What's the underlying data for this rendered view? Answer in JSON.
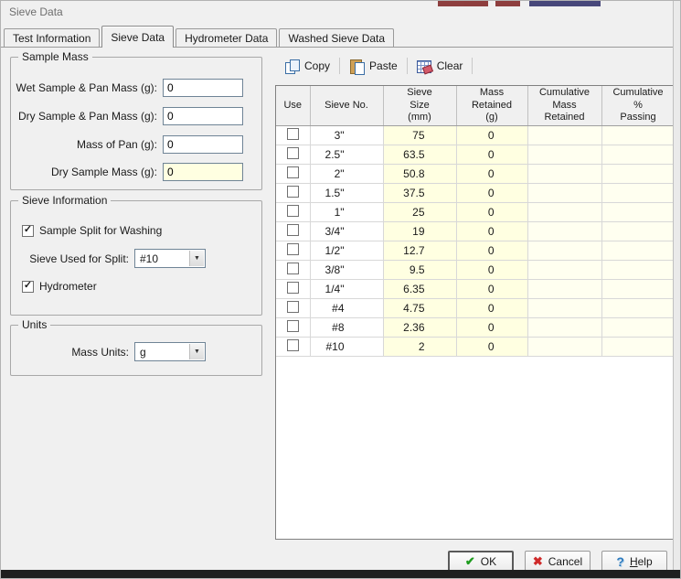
{
  "window": {
    "title": "Sieve Data"
  },
  "tabs": [
    {
      "label": "Test Information"
    },
    {
      "label": "Sieve Data"
    },
    {
      "label": "Hydrometer Data"
    },
    {
      "label": "Washed Sieve Data"
    }
  ],
  "sample_mass": {
    "title": "Sample Mass",
    "fields": [
      {
        "label": "Wet Sample & Pan Mass (g):",
        "value": "0"
      },
      {
        "label": "Dry Sample & Pan Mass (g):",
        "value": "0"
      },
      {
        "label": "Mass of Pan (g):",
        "value": "0"
      },
      {
        "label": "Dry Sample Mass (g):",
        "value": "0"
      }
    ]
  },
  "sieve_information": {
    "title": "Sieve Information",
    "sample_split_label": "Sample Split for Washing",
    "sample_split_checked": true,
    "sieve_used_label": "Sieve Used for Split:",
    "sieve_used_value": "#10",
    "hydrometer_label": "Hydrometer",
    "hydrometer_checked": true
  },
  "units": {
    "title": "Units",
    "mass_units_label": "Mass Units:",
    "mass_units_value": "g"
  },
  "toolbar": {
    "copy": "Copy",
    "paste": "Paste",
    "clear": "Clear"
  },
  "table": {
    "headers": [
      "Use",
      "Sieve No.",
      "Sieve\nSize\n(mm)",
      "Mass\nRetained\n(g)",
      "Cumulative\nMass\nRetained",
      "Cumulative\n%\nPassing"
    ],
    "rows": [
      {
        "no": "3\"",
        "size": "75",
        "mass": "0",
        "cum_mass": "",
        "cum_pass": ""
      },
      {
        "no": "2.5\"",
        "size": "63.5",
        "mass": "0",
        "cum_mass": "",
        "cum_pass": ""
      },
      {
        "no": "2\"",
        "size": "50.8",
        "mass": "0",
        "cum_mass": "",
        "cum_pass": ""
      },
      {
        "no": "1.5\"",
        "size": "37.5",
        "mass": "0",
        "cum_mass": "",
        "cum_pass": ""
      },
      {
        "no": "1\"",
        "size": "25",
        "mass": "0",
        "cum_mass": "",
        "cum_pass": ""
      },
      {
        "no": "3/4\"",
        "size": "19",
        "mass": "0",
        "cum_mass": "",
        "cum_pass": ""
      },
      {
        "no": "1/2\"",
        "size": "12.7",
        "mass": "0",
        "cum_mass": "",
        "cum_pass": ""
      },
      {
        "no": "3/8\"",
        "size": "9.5",
        "mass": "0",
        "cum_mass": "",
        "cum_pass": ""
      },
      {
        "no": "1/4\"",
        "size": "6.35",
        "mass": "0",
        "cum_mass": "",
        "cum_pass": ""
      },
      {
        "no": "#4",
        "size": "4.75",
        "mass": "0",
        "cum_mass": "",
        "cum_pass": ""
      },
      {
        "no": "#8",
        "size": "2.36",
        "mass": "0",
        "cum_mass": "",
        "cum_pass": ""
      },
      {
        "no": "#10",
        "size": "2",
        "mass": "0",
        "cum_mass": "",
        "cum_pass": ""
      }
    ]
  },
  "buttons": {
    "ok": "OK",
    "cancel": "Cancel",
    "help_accel": "H",
    "help_rest": "elp"
  },
  "icons": {
    "check": "✓",
    "dropdown": "▼",
    "ok": "✔",
    "cancel": "✖",
    "help": "?"
  },
  "colors": {
    "field_highlight": "#ffffe1",
    "grid_yellow": "#ffffe1",
    "ok_check": "#1f9c1f",
    "cancel_x": "#cf2a2a",
    "help_q": "#2d7bbf"
  }
}
